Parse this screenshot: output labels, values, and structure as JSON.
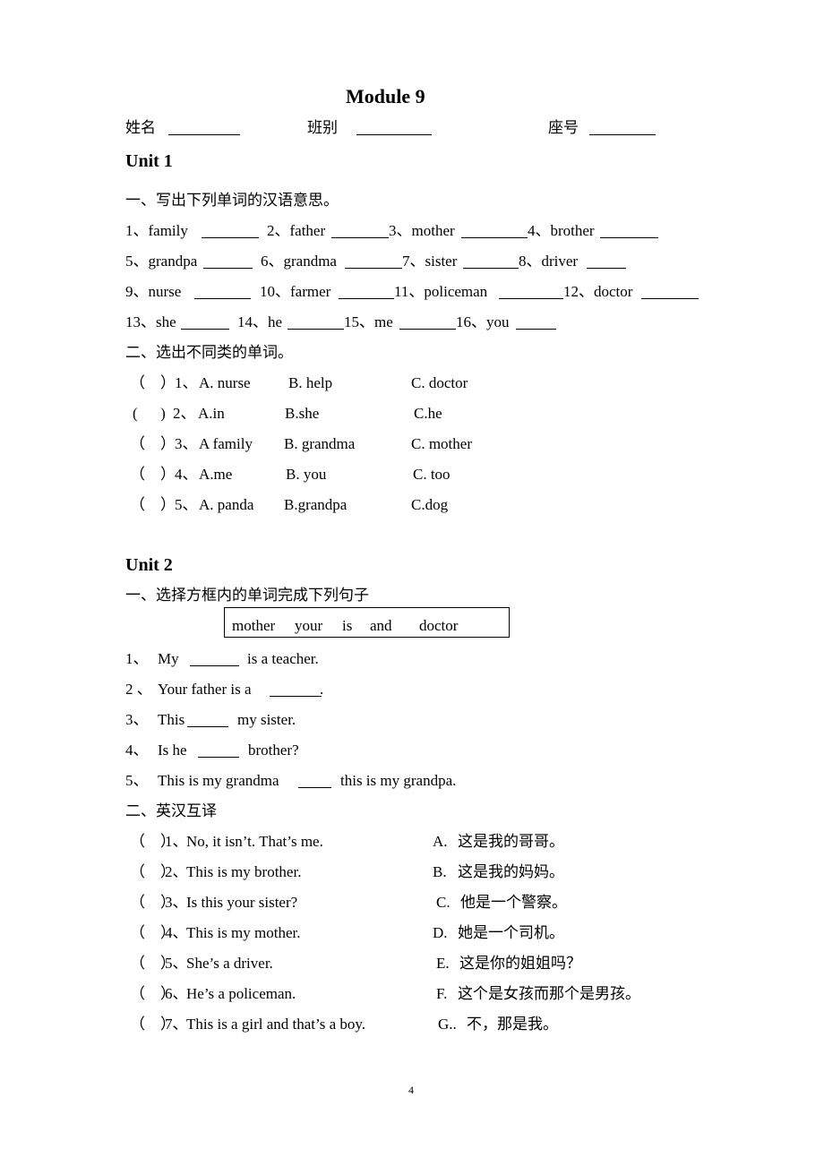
{
  "header": {
    "title": "Module 9",
    "name_label": "姓名",
    "class_label": "班别",
    "seat_label": "座号"
  },
  "unit1": {
    "heading": "Unit 1",
    "section1": {
      "instruction": "一、写出下列单词的汉语意思。",
      "items": [
        {
          "num": "1、",
          "word": "family"
        },
        {
          "num": "2、",
          "word": "father"
        },
        {
          "num": "3、",
          "word": "mother"
        },
        {
          "num": "4、",
          "word": "brother"
        },
        {
          "num": "5、",
          "word": "grandpa"
        },
        {
          "num": "6、",
          "word": "grandma"
        },
        {
          "num": "7、",
          "word": "sister"
        },
        {
          "num": "8、",
          "word": "driver"
        },
        {
          "num": "9、",
          "word": "nurse"
        },
        {
          "num": "10、",
          "word": "farmer"
        },
        {
          "num": "11、",
          "word": "policeman"
        },
        {
          "num": "12、",
          "word": "doctor"
        },
        {
          "num": "13、",
          "word": "she"
        },
        {
          "num": "14、",
          "word": "he"
        },
        {
          "num": "15、",
          "word": "me"
        },
        {
          "num": "16、",
          "word": "you"
        }
      ]
    },
    "section2": {
      "instruction": "二、选出不同类的单词。",
      "items": [
        {
          "paren": "（    ）",
          "num": "1、",
          "a": "A. nurse",
          "b": "B. help",
          "c": "C. doctor"
        },
        {
          "paren": "(      )",
          "num": "2、",
          "a": "A.in",
          "b": "B.she",
          "c": "C.he"
        },
        {
          "paren": "（    ）",
          "num": "3、",
          "a": "A family",
          "b": "B. grandma",
          "c": "C. mother"
        },
        {
          "paren": "（    ）",
          "num": "4、",
          "a": "A.me",
          "b": "B. you",
          "c": "C. too"
        },
        {
          "paren": "（    ）",
          "num": "5、",
          "a": "A. panda",
          "b": "B.grandpa",
          "c": "C.dog"
        }
      ]
    }
  },
  "unit2": {
    "heading": "Unit 2",
    "section1": {
      "instruction": "一、选择方框内的单词完成下列句子",
      "word_box": [
        "mother",
        "your",
        "is",
        "and",
        "doctor"
      ],
      "items": [
        {
          "num": "1、",
          "before": "My",
          "after": "is a teacher."
        },
        {
          "num": "2 、",
          "before": "Your father is a",
          "after": "."
        },
        {
          "num": "3、",
          "before": "This",
          "after": "my sister."
        },
        {
          "num": "4、",
          "before": "Is he",
          "after": "brother?"
        },
        {
          "num": "5、",
          "before": "This is my grandma",
          "after": "this is my grandpa."
        }
      ]
    },
    "section2": {
      "instruction": "二、英汉互译",
      "items": [
        {
          "paren": "（    ）",
          "num": "1、",
          "en": "No, it isn’t. That’s me.",
          "opt": "A.",
          "zh": "这是我的哥哥。"
        },
        {
          "paren": "（    ）",
          "num": "2、",
          "en": "This is my brother.",
          "opt": "B.",
          "zh": "这是我的妈妈。"
        },
        {
          "paren": "（    ）",
          "num": "3、",
          "en": "Is this your sister?",
          "opt": "C.",
          "zh": "他是一个警察。"
        },
        {
          "paren": "（    ）",
          "num": "4、",
          "en": "This is my mother.",
          "opt": "D.",
          "zh": "她是一个司机。"
        },
        {
          "paren": "（    ）",
          "num": "5、",
          "en": "She’s a driver.",
          "opt": "E.",
          "zh": "这是你的姐姐吗？"
        },
        {
          "paren": "（    ）",
          "num": "6、",
          "en": "He’s a policeman.",
          "opt": "F.",
          "zh": "这个是女孩而那个是男孩。"
        },
        {
          "paren": "（    ）",
          "num": "7、",
          "en": "This is a girl and that’s a boy.",
          "opt": "G..",
          "zh": "不，那是我。"
        }
      ]
    }
  },
  "footer": {
    "page_number": "4"
  }
}
